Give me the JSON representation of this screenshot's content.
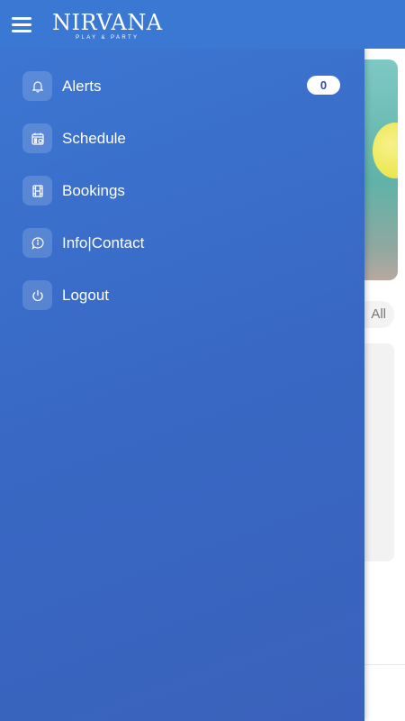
{
  "app": {
    "logo_main": "NIRVANA",
    "logo_sub": "PLAY & PARTY"
  },
  "menu": {
    "items": [
      {
        "label": "Alerts",
        "icon": "bell-icon",
        "badge": "0"
      },
      {
        "label": "Schedule",
        "icon": "calendar-icon"
      },
      {
        "label": "Bookings",
        "icon": "film-icon"
      },
      {
        "label": "Info|Contact",
        "icon": "chat-info-icon"
      },
      {
        "label": "Logout",
        "icon": "power-icon"
      }
    ]
  },
  "background": {
    "filter_label": "All"
  },
  "colors": {
    "header": "#3a78d4",
    "drawer": "#3868c4",
    "badge_text": "#2a4fa0"
  }
}
